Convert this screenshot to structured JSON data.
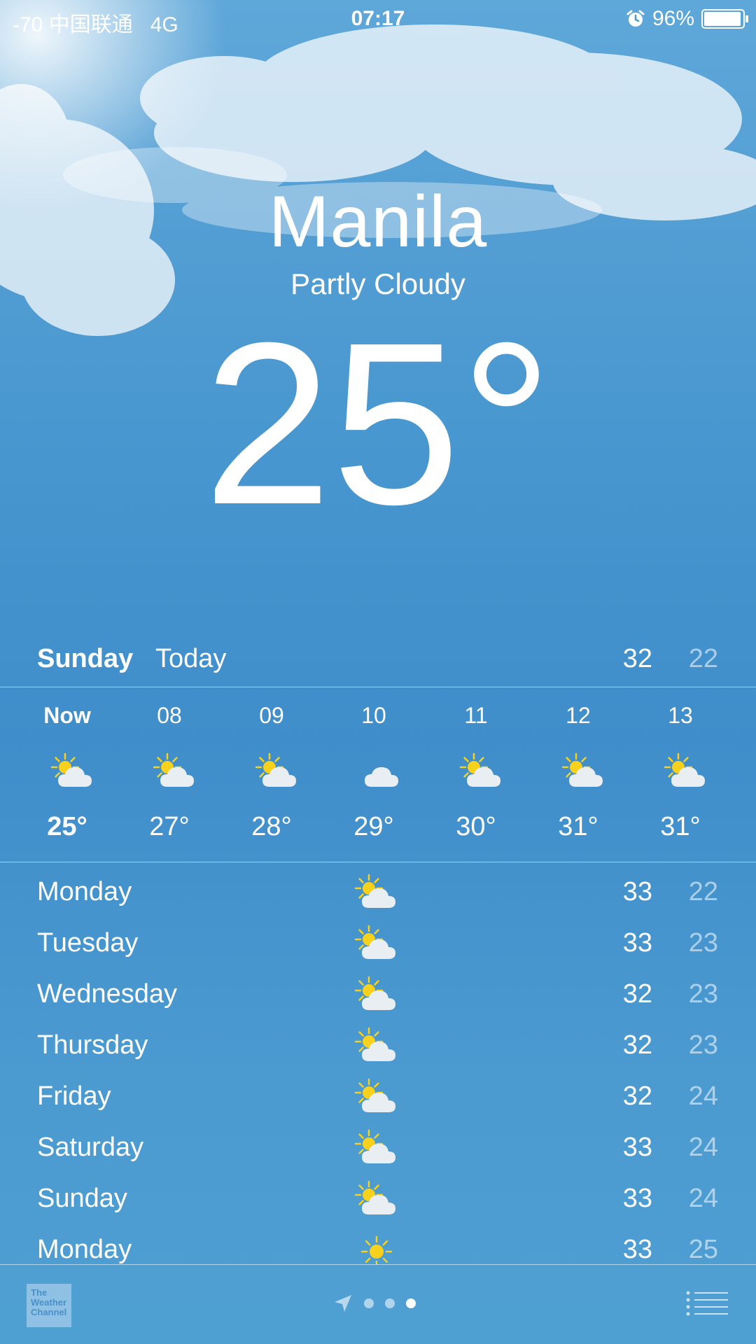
{
  "status_bar": {
    "carrier": "-70 中国联通",
    "network": "4G",
    "time": "07:17",
    "battery": "96%",
    "battery_level": 0.96
  },
  "location": {
    "city": "Manila",
    "condition": "Partly Cloudy",
    "temperature": "25°"
  },
  "today": {
    "day": "Sunday",
    "label": "Today",
    "high": "32",
    "low": "22"
  },
  "hourly": [
    {
      "time": "Now",
      "icon": "partly-cloudy-icon",
      "temp": "25°"
    },
    {
      "time": "08",
      "icon": "partly-cloudy-icon",
      "temp": "27°"
    },
    {
      "time": "09",
      "icon": "partly-cloudy-icon",
      "temp": "28°"
    },
    {
      "time": "10",
      "icon": "cloud-icon",
      "temp": "29°"
    },
    {
      "time": "11",
      "icon": "partly-cloudy-icon",
      "temp": "30°"
    },
    {
      "time": "12",
      "icon": "partly-cloudy-icon",
      "temp": "31°"
    },
    {
      "time": "13",
      "icon": "partly-cloudy-icon",
      "temp": "31°"
    }
  ],
  "daily": [
    {
      "day": "Monday",
      "icon": "partly-cloudy-icon",
      "high": "33",
      "low": "22"
    },
    {
      "day": "Tuesday",
      "icon": "partly-cloudy-icon",
      "high": "33",
      "low": "23"
    },
    {
      "day": "Wednesday",
      "icon": "partly-cloudy-icon",
      "high": "32",
      "low": "23"
    },
    {
      "day": "Thursday",
      "icon": "partly-cloudy-icon",
      "high": "32",
      "low": "23"
    },
    {
      "day": "Friday",
      "icon": "partly-cloudy-icon",
      "high": "32",
      "low": "24"
    },
    {
      "day": "Saturday",
      "icon": "partly-cloudy-icon",
      "high": "33",
      "low": "24"
    },
    {
      "day": "Sunday",
      "icon": "partly-cloudy-icon",
      "high": "33",
      "low": "24"
    },
    {
      "day": "Monday",
      "icon": "sun-icon",
      "high": "33",
      "low": "25"
    }
  ],
  "footer": {
    "logo_text": "The Weather Channel",
    "page_count": 3,
    "active_page": 3
  },
  "colors": {
    "sun": "#f7d11c",
    "cloud": "#e9eef3"
  }
}
